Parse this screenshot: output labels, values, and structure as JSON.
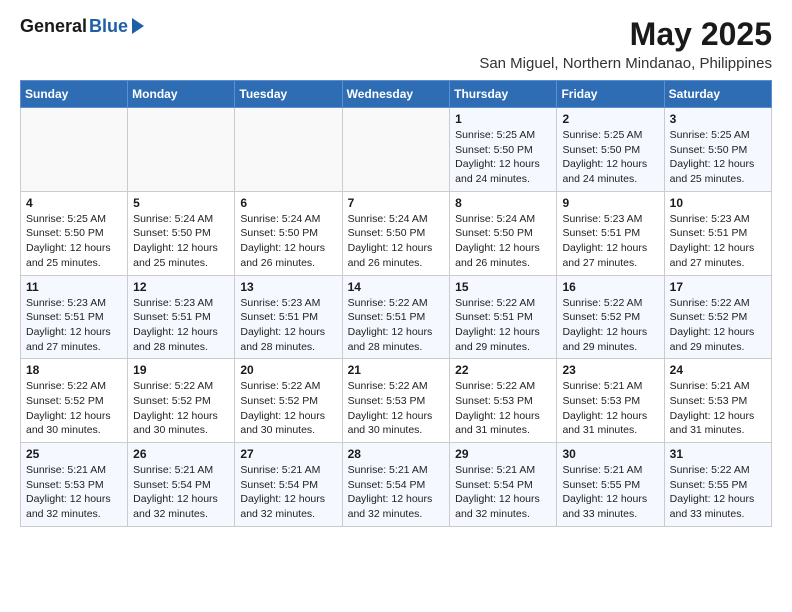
{
  "header": {
    "logo_general": "General",
    "logo_blue": "Blue",
    "month_title": "May 2025",
    "subtitle": "San Miguel, Northern Mindanao, Philippines"
  },
  "days_of_week": [
    "Sunday",
    "Monday",
    "Tuesday",
    "Wednesday",
    "Thursday",
    "Friday",
    "Saturday"
  ],
  "weeks": [
    [
      {
        "day": "",
        "info": ""
      },
      {
        "day": "",
        "info": ""
      },
      {
        "day": "",
        "info": ""
      },
      {
        "day": "",
        "info": ""
      },
      {
        "day": "1",
        "info": "Sunrise: 5:25 AM\nSunset: 5:50 PM\nDaylight: 12 hours\nand 24 minutes."
      },
      {
        "day": "2",
        "info": "Sunrise: 5:25 AM\nSunset: 5:50 PM\nDaylight: 12 hours\nand 24 minutes."
      },
      {
        "day": "3",
        "info": "Sunrise: 5:25 AM\nSunset: 5:50 PM\nDaylight: 12 hours\nand 25 minutes."
      }
    ],
    [
      {
        "day": "4",
        "info": "Sunrise: 5:25 AM\nSunset: 5:50 PM\nDaylight: 12 hours\nand 25 minutes."
      },
      {
        "day": "5",
        "info": "Sunrise: 5:24 AM\nSunset: 5:50 PM\nDaylight: 12 hours\nand 25 minutes."
      },
      {
        "day": "6",
        "info": "Sunrise: 5:24 AM\nSunset: 5:50 PM\nDaylight: 12 hours\nand 26 minutes."
      },
      {
        "day": "7",
        "info": "Sunrise: 5:24 AM\nSunset: 5:50 PM\nDaylight: 12 hours\nand 26 minutes."
      },
      {
        "day": "8",
        "info": "Sunrise: 5:24 AM\nSunset: 5:50 PM\nDaylight: 12 hours\nand 26 minutes."
      },
      {
        "day": "9",
        "info": "Sunrise: 5:23 AM\nSunset: 5:51 PM\nDaylight: 12 hours\nand 27 minutes."
      },
      {
        "day": "10",
        "info": "Sunrise: 5:23 AM\nSunset: 5:51 PM\nDaylight: 12 hours\nand 27 minutes."
      }
    ],
    [
      {
        "day": "11",
        "info": "Sunrise: 5:23 AM\nSunset: 5:51 PM\nDaylight: 12 hours\nand 27 minutes."
      },
      {
        "day": "12",
        "info": "Sunrise: 5:23 AM\nSunset: 5:51 PM\nDaylight: 12 hours\nand 28 minutes."
      },
      {
        "day": "13",
        "info": "Sunrise: 5:23 AM\nSunset: 5:51 PM\nDaylight: 12 hours\nand 28 minutes."
      },
      {
        "day": "14",
        "info": "Sunrise: 5:22 AM\nSunset: 5:51 PM\nDaylight: 12 hours\nand 28 minutes."
      },
      {
        "day": "15",
        "info": "Sunrise: 5:22 AM\nSunset: 5:51 PM\nDaylight: 12 hours\nand 29 minutes."
      },
      {
        "day": "16",
        "info": "Sunrise: 5:22 AM\nSunset: 5:52 PM\nDaylight: 12 hours\nand 29 minutes."
      },
      {
        "day": "17",
        "info": "Sunrise: 5:22 AM\nSunset: 5:52 PM\nDaylight: 12 hours\nand 29 minutes."
      }
    ],
    [
      {
        "day": "18",
        "info": "Sunrise: 5:22 AM\nSunset: 5:52 PM\nDaylight: 12 hours\nand 30 minutes."
      },
      {
        "day": "19",
        "info": "Sunrise: 5:22 AM\nSunset: 5:52 PM\nDaylight: 12 hours\nand 30 minutes."
      },
      {
        "day": "20",
        "info": "Sunrise: 5:22 AM\nSunset: 5:52 PM\nDaylight: 12 hours\nand 30 minutes."
      },
      {
        "day": "21",
        "info": "Sunrise: 5:22 AM\nSunset: 5:53 PM\nDaylight: 12 hours\nand 30 minutes."
      },
      {
        "day": "22",
        "info": "Sunrise: 5:22 AM\nSunset: 5:53 PM\nDaylight: 12 hours\nand 31 minutes."
      },
      {
        "day": "23",
        "info": "Sunrise: 5:21 AM\nSunset: 5:53 PM\nDaylight: 12 hours\nand 31 minutes."
      },
      {
        "day": "24",
        "info": "Sunrise: 5:21 AM\nSunset: 5:53 PM\nDaylight: 12 hours\nand 31 minutes."
      }
    ],
    [
      {
        "day": "25",
        "info": "Sunrise: 5:21 AM\nSunset: 5:53 PM\nDaylight: 12 hours\nand 32 minutes."
      },
      {
        "day": "26",
        "info": "Sunrise: 5:21 AM\nSunset: 5:54 PM\nDaylight: 12 hours\nand 32 minutes."
      },
      {
        "day": "27",
        "info": "Sunrise: 5:21 AM\nSunset: 5:54 PM\nDaylight: 12 hours\nand 32 minutes."
      },
      {
        "day": "28",
        "info": "Sunrise: 5:21 AM\nSunset: 5:54 PM\nDaylight: 12 hours\nand 32 minutes."
      },
      {
        "day": "29",
        "info": "Sunrise: 5:21 AM\nSunset: 5:54 PM\nDaylight: 12 hours\nand 32 minutes."
      },
      {
        "day": "30",
        "info": "Sunrise: 5:21 AM\nSunset: 5:55 PM\nDaylight: 12 hours\nand 33 minutes."
      },
      {
        "day": "31",
        "info": "Sunrise: 5:22 AM\nSunset: 5:55 PM\nDaylight: 12 hours\nand 33 minutes."
      }
    ]
  ]
}
